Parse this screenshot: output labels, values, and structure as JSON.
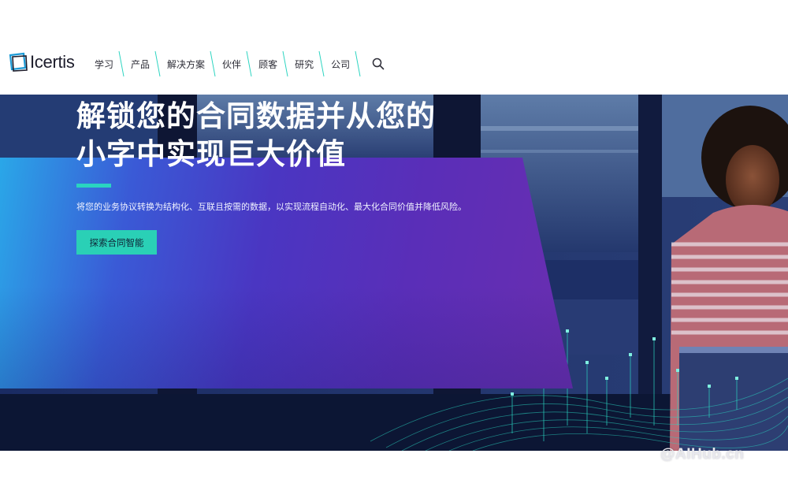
{
  "brand": {
    "name": "Icertis"
  },
  "nav": {
    "items": [
      {
        "label": "学习"
      },
      {
        "label": "产品"
      },
      {
        "label": "解决方案"
      },
      {
        "label": "伙伴"
      },
      {
        "label": "顾客"
      },
      {
        "label": "研究"
      },
      {
        "label": "公司"
      }
    ],
    "search_icon": "search-icon"
  },
  "hero": {
    "title_line1": "解锁您的合同数据并从您的",
    "title_line2": "小字中实现巨大价值",
    "subtitle": "将您的业务协议转换为结构化、互联且按需的数据，以实现流程自动化、最大化合同价值并降低风险。",
    "cta_label": "探索合同智能"
  },
  "watermark": "@AIHub.cn",
  "colors": {
    "accent": "#2ad0b6",
    "panel_start": "#2aa7e8",
    "panel_end": "#6a2eb0",
    "nav_separator": "#2ad4c0"
  }
}
